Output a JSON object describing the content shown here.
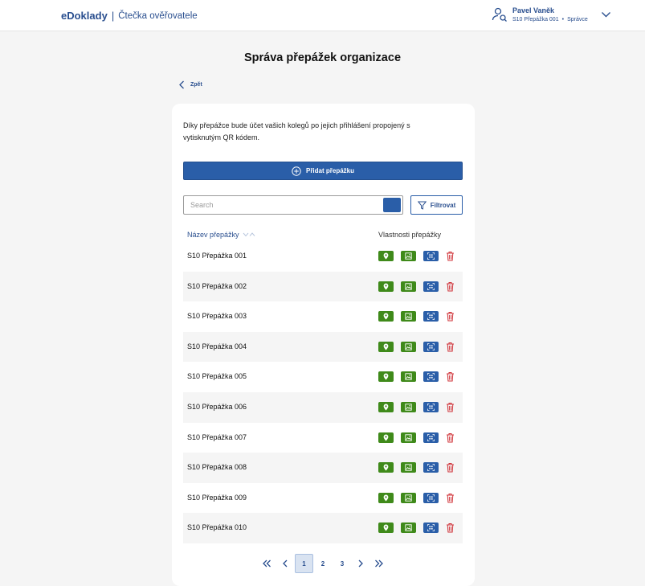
{
  "header": {
    "brand": "eDoklady",
    "separator": "|",
    "app_name": "Čtečka ověřovatele",
    "user": {
      "name": "Pavel Vaněk",
      "location": "S10 Přepážka 001",
      "role": "Správce"
    }
  },
  "page": {
    "title": "Správa přepážek organizace",
    "back_label": "Zpět",
    "intro": "Díky přepážce bude účet vašich kolegů po jejich přihlášení propojený s vytisknutým QR kódem.",
    "add_button": "Přidat přepážku",
    "search_placeholder": "Search",
    "filter_label": "Filtrovat"
  },
  "table": {
    "col_name": "Název přepážky",
    "col_props": "Vlastnosti přepážky",
    "rows": [
      "S10 Přepážka 001",
      "S10 Přepážka 002",
      "S10 Přepážka 003",
      "S10 Přepážka 004",
      "S10 Přepážka 005",
      "S10 Přepážka 006",
      "S10 Přepážka 007",
      "S10 Přepážka 008",
      "S10 Přepážka 009",
      "S10 Přepážka 010"
    ]
  },
  "pagination": {
    "pages": [
      "1",
      "2",
      "3"
    ],
    "current": "1"
  },
  "colors": {
    "brand_blue": "#2a5ea8",
    "green": "#3f8a1a",
    "delete_red": "#d0343a"
  }
}
